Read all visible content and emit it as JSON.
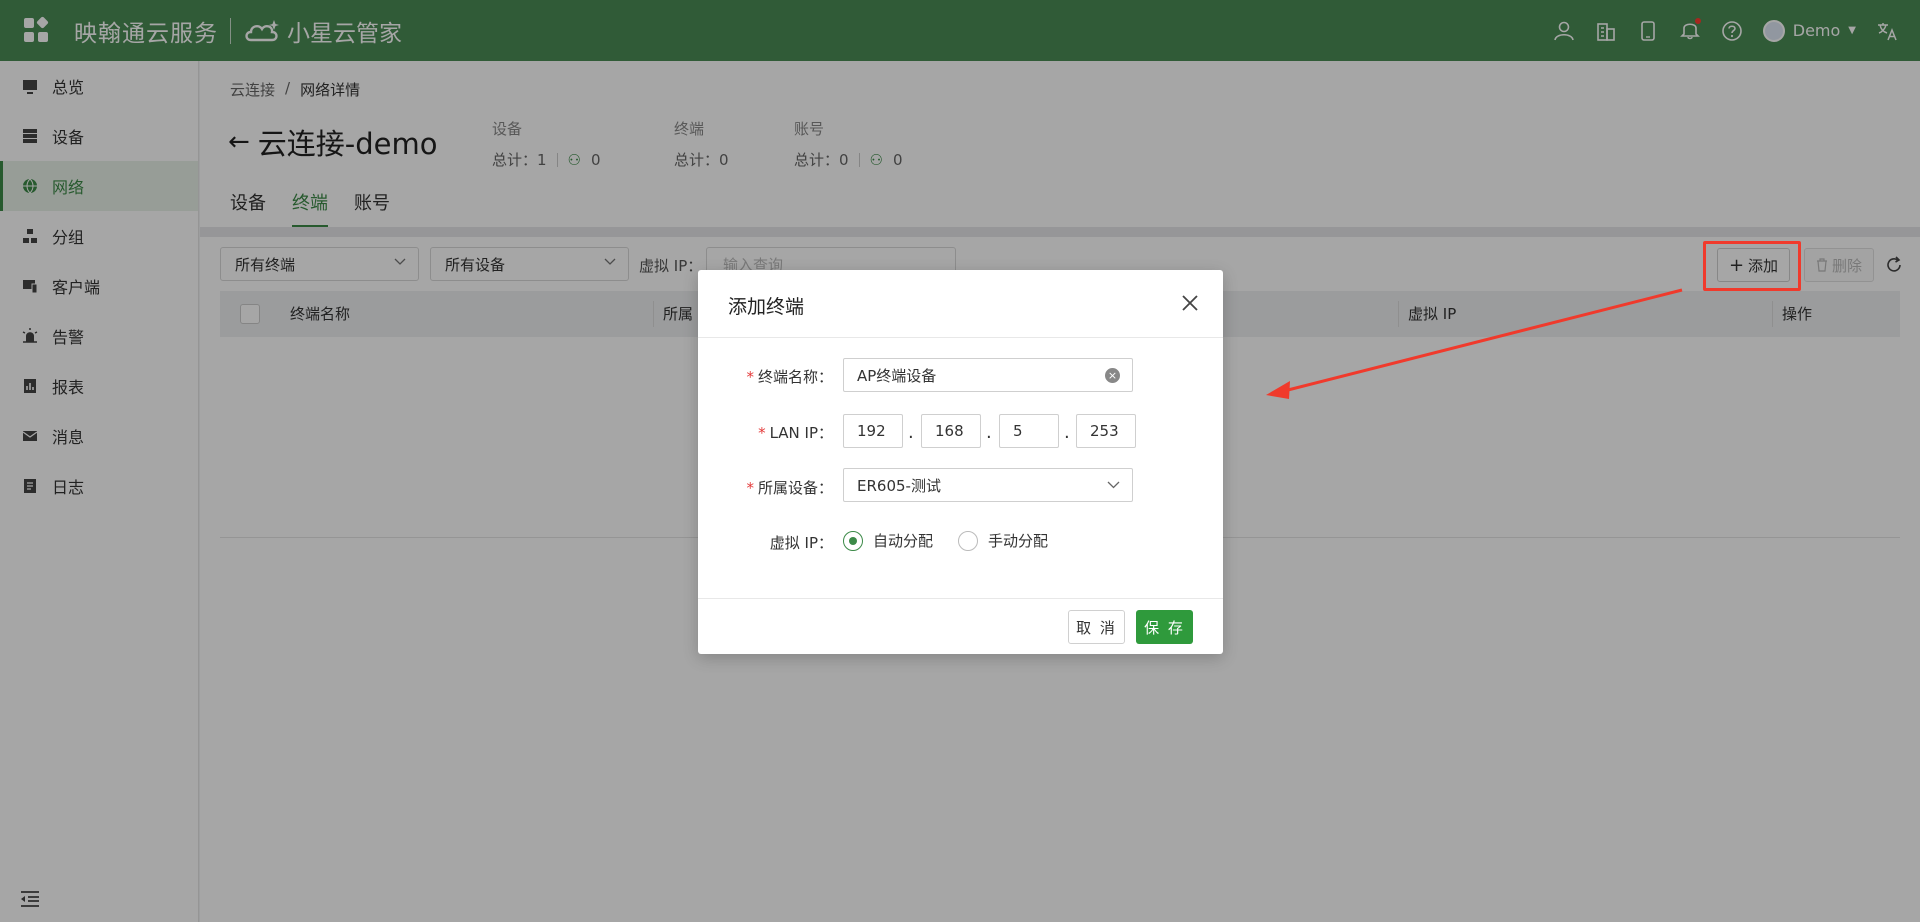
{
  "header": {
    "brand_primary": "映翰通云服务",
    "brand_secondary": "小星云管家",
    "user_name": "Demo",
    "colors": {
      "bar": "#4a8d55",
      "accent": "#3c8a48",
      "save": "#2f9a3c",
      "annotation": "#f03a2c"
    }
  },
  "sidebar": {
    "items": [
      {
        "label": "总览",
        "icon": "monitor-icon"
      },
      {
        "label": "设备",
        "icon": "server-icon"
      },
      {
        "label": "网络",
        "icon": "globe-icon"
      },
      {
        "label": "分组",
        "icon": "group-icon"
      },
      {
        "label": "客户端",
        "icon": "clients-icon"
      },
      {
        "label": "告警",
        "icon": "alarm-icon"
      },
      {
        "label": "报表",
        "icon": "report-icon"
      },
      {
        "label": "消息",
        "icon": "mail-icon"
      },
      {
        "label": "日志",
        "icon": "log-icon"
      }
    ]
  },
  "breadcrumb": {
    "root": "云连接",
    "sep": "/",
    "current": "网络详情"
  },
  "page": {
    "title": "云连接-demo"
  },
  "stats": {
    "device": {
      "label": "设备",
      "total": "总计：1",
      "online": "0"
    },
    "terminal": {
      "label": "终端",
      "total": "总计：0"
    },
    "account": {
      "label": "账号",
      "total": "总计：0",
      "online": "0"
    }
  },
  "tabs": [
    {
      "label": "设备"
    },
    {
      "label": "终端"
    },
    {
      "label": "账号"
    }
  ],
  "toolbar": {
    "filter_terminal": "所有终端",
    "filter_device": "所有设备",
    "vip_label": "虚拟 IP：",
    "vip_placeholder": "输入查询",
    "add_label": "添加",
    "delete_label": "删除"
  },
  "table": {
    "columns": [
      "终端名称",
      "所属",
      "虚拟 IP",
      "操作"
    ]
  },
  "modal": {
    "title": "添加终端",
    "fields": {
      "name": {
        "label": "终端名称：",
        "value": "AP终端设备"
      },
      "lan_ip": {
        "label": "LAN IP：",
        "octets": [
          "192",
          "168",
          "5",
          "253"
        ]
      },
      "device": {
        "label": "所属设备：",
        "value": "ER605-测试"
      },
      "vip": {
        "label": "虚拟 IP：",
        "options": [
          "自动分配",
          "手动分配"
        ],
        "selected": "自动分配"
      }
    },
    "cancel_label": "取 消",
    "save_label": "保 存"
  }
}
